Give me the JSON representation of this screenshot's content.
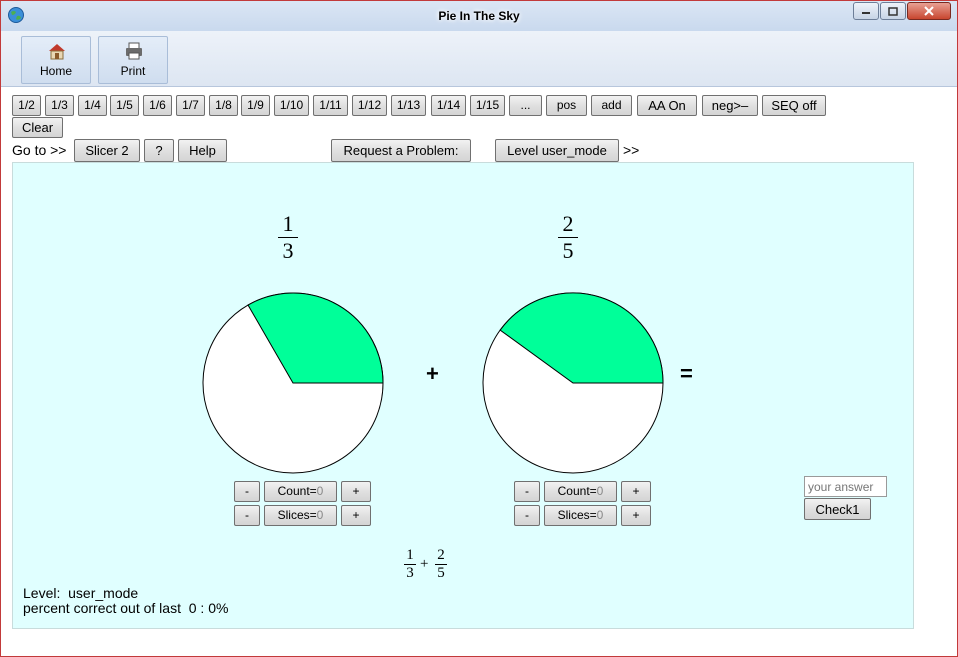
{
  "window": {
    "title": "Pie In The Sky"
  },
  "ribbon": {
    "home_label": "Home",
    "print_label": "Print"
  },
  "fraction_buttons": [
    "1/2",
    "1/3",
    "1/4",
    "1/5",
    "1/6",
    "1/7",
    "1/8",
    "1/9",
    "1/10",
    "1/11",
    "1/12",
    "1/13",
    "1/14",
    "1/15",
    "...",
    "pos",
    "add",
    "AA On",
    "neg>–",
    "SEQ off",
    "Clear"
  ],
  "nav": {
    "goto_label": "Go to >>",
    "slicer_label": "Slicer 2",
    "question_label": "?",
    "help_label": "Help",
    "request_label": "Request a Problem:",
    "level_label": "Level user_mode",
    "after_label": ">>"
  },
  "problem": {
    "left": {
      "numerator": "1",
      "denominator": "3",
      "fraction": 0.3333
    },
    "right": {
      "numerator": "2",
      "denominator": "5",
      "fraction": 0.4
    },
    "plus": "+",
    "equals": "=",
    "pie_fill_color": "#00ff99",
    "expression": {
      "plus": "+"
    }
  },
  "controls": {
    "minus": "-",
    "plus": "+",
    "count_label": "Count=",
    "count_value": "0",
    "slices_label": "Slices=",
    "slices_value": "0"
  },
  "answer": {
    "placeholder": "your answer",
    "check_label": "Check1"
  },
  "status": {
    "level_line": "Level:  user_mode",
    "percent_line": "percent correct out of last  0 : 0%"
  }
}
